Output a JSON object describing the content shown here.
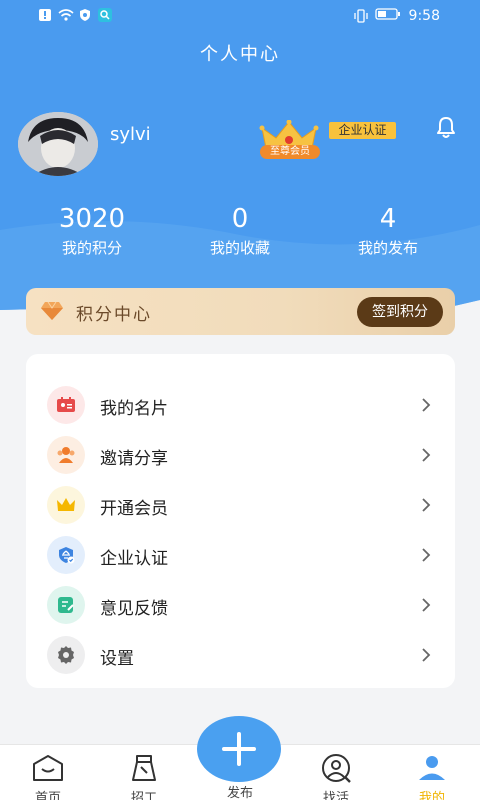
{
  "status_bar": {
    "time": "9:58"
  },
  "header": {
    "title": "个人中心"
  },
  "profile": {
    "username": "sylvi",
    "vip_label": "至尊会员",
    "enterprise_badge": "企业认证"
  },
  "stats": [
    {
      "value": "3020",
      "label": "我的积分"
    },
    {
      "value": "0",
      "label": "我的收藏"
    },
    {
      "value": "4",
      "label": "我的发布"
    }
  ],
  "points": {
    "title": "积分中心",
    "sign_button": "签到积分"
  },
  "menu": [
    {
      "label": "我的名片",
      "icon": "business-card-icon"
    },
    {
      "label": "邀请分享",
      "icon": "invite-users-icon"
    },
    {
      "label": "开通会员",
      "icon": "crown-icon"
    },
    {
      "label": "企业认证",
      "icon": "enterprise-verify-icon"
    },
    {
      "label": "意见反馈",
      "icon": "feedback-icon"
    },
    {
      "label": "设置",
      "icon": "gear-icon"
    }
  ],
  "tabs": [
    {
      "label": "首页",
      "icon": "home-icon"
    },
    {
      "label": "招工",
      "icon": "recruit-icon"
    },
    {
      "label": "发布",
      "icon": "plus-icon"
    },
    {
      "label": "找活",
      "icon": "find-job-icon"
    },
    {
      "label": "我的",
      "icon": "profile-icon"
    }
  ],
  "colors": {
    "header_blue": "#4a9bef",
    "active_tab": "#f0b400",
    "sign_button": "#5b3a17",
    "fab": "#4aa0f0"
  }
}
